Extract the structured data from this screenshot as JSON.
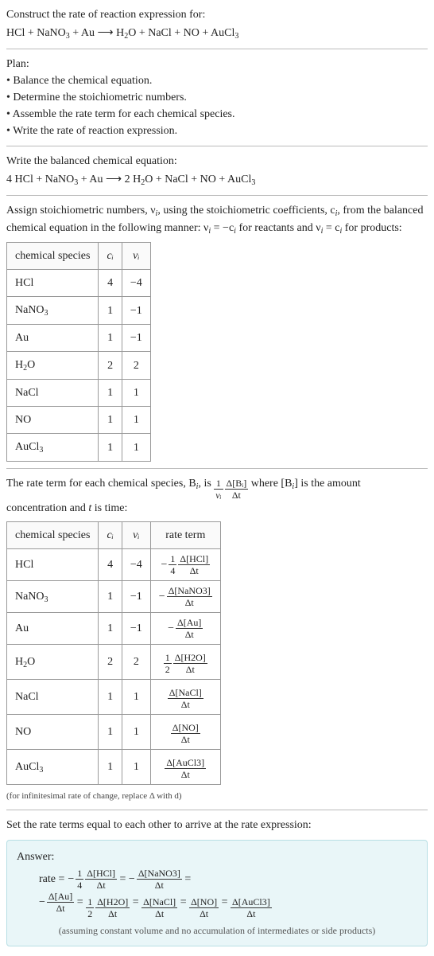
{
  "header": {
    "construct_label": "Construct the rate of reaction expression for:",
    "equation_a": "HCl + NaNO",
    "equation_b": " + Au  ⟶  H",
    "equation_c": "O + NaCl + NO + AuCl"
  },
  "plan": {
    "title": "Plan:",
    "items": [
      "• Balance the chemical equation.",
      "• Determine the stoichiometric numbers.",
      "• Assemble the rate term for each chemical species.",
      "• Write the rate of reaction expression."
    ]
  },
  "balanced": {
    "title": "Write the balanced chemical equation:",
    "eq_a": "4 HCl + NaNO",
    "eq_b": " + Au  ⟶  2 H",
    "eq_c": "O + NaCl + NO + AuCl"
  },
  "assign": {
    "line1_a": "Assign stoichiometric numbers, ν",
    "line1_b": ", using the stoichiometric coefficients, c",
    "line1_c": ", from",
    "line2_a": "the balanced chemical equation in the following manner: ν",
    "line2_b": " = −c",
    "line2_c": " for reactants",
    "line3_a": "and ν",
    "line3_b": " = c",
    "line3_c": " for products:"
  },
  "table1": {
    "headers": {
      "species": "chemical species",
      "c": "cᵢ",
      "v": "νᵢ"
    },
    "rows": [
      {
        "species_a": "HCl",
        "species_b": "",
        "c": "4",
        "v": "−4"
      },
      {
        "species_a": "NaNO",
        "species_b": "3",
        "c": "1",
        "v": "−1"
      },
      {
        "species_a": "Au",
        "species_b": "",
        "c": "1",
        "v": "−1"
      },
      {
        "species_a": "H",
        "species_b": "2",
        "species_c": "O",
        "c": "2",
        "v": "2"
      },
      {
        "species_a": "NaCl",
        "species_b": "",
        "c": "1",
        "v": "1"
      },
      {
        "species_a": "NO",
        "species_b": "",
        "c": "1",
        "v": "1"
      },
      {
        "species_a": "AuCl",
        "species_b": "3",
        "c": "1",
        "v": "1"
      }
    ]
  },
  "rate_intro": {
    "a": "The rate term for each chemical species, B",
    "b": ", is ",
    "c": " where [B",
    "d": "] is the amount",
    "line2": "concentration and t is time:",
    "frac1_num": "1",
    "frac1_den": "νᵢ",
    "frac2_num": "Δ[Bᵢ]",
    "frac2_den": "Δt"
  },
  "table2": {
    "headers": {
      "species": "chemical species",
      "c": "cᵢ",
      "v": "νᵢ",
      "rate": "rate term"
    },
    "rows": [
      {
        "species_a": "HCl",
        "c": "4",
        "v": "−4",
        "sign": "−",
        "coef_num": "1",
        "coef_den": "4",
        "num": "Δ[HCl]",
        "den": "Δt"
      },
      {
        "species_a": "NaNO",
        "species_b": "3",
        "c": "1",
        "v": "−1",
        "sign": "−",
        "coef_num": "",
        "coef_den": "",
        "num": "Δ[NaNO3]",
        "den": "Δt"
      },
      {
        "species_a": "Au",
        "c": "1",
        "v": "−1",
        "sign": "−",
        "coef_num": "",
        "coef_den": "",
        "num": "Δ[Au]",
        "den": "Δt"
      },
      {
        "species_a": "H",
        "species_b": "2",
        "species_c": "O",
        "c": "2",
        "v": "2",
        "sign": "",
        "coef_num": "1",
        "coef_den": "2",
        "num": "Δ[H2O]",
        "den": "Δt"
      },
      {
        "species_a": "NaCl",
        "c": "1",
        "v": "1",
        "sign": "",
        "coef_num": "",
        "coef_den": "",
        "num": "Δ[NaCl]",
        "den": "Δt"
      },
      {
        "species_a": "NO",
        "c": "1",
        "v": "1",
        "sign": "",
        "coef_num": "",
        "coef_den": "",
        "num": "Δ[NO]",
        "den": "Δt"
      },
      {
        "species_a": "AuCl",
        "species_b": "3",
        "c": "1",
        "v": "1",
        "sign": "",
        "coef_num": "",
        "coef_den": "",
        "num": "Δ[AuCl3]",
        "den": "Δt"
      }
    ]
  },
  "infinitesimal_note": "(for infinitesimal rate of change, replace Δ with d)",
  "set_equal": "Set the rate terms equal to each other to arrive at the rate expression:",
  "answer": {
    "title": "Answer:",
    "rate_label": "rate = ",
    "terms": [
      {
        "sign": "−",
        "coef_num": "1",
        "coef_den": "4",
        "num": "Δ[HCl]",
        "den": "Δt",
        "tail": " = "
      },
      {
        "sign": "−",
        "coef_num": "",
        "coef_den": "",
        "num": "Δ[NaNO3]",
        "den": "Δt",
        "tail": " ="
      }
    ],
    "terms2": [
      {
        "sign": "−",
        "coef_num": "",
        "coef_den": "",
        "num": "Δ[Au]",
        "den": "Δt",
        "tail": " = "
      },
      {
        "sign": "",
        "coef_num": "1",
        "coef_den": "2",
        "num": "Δ[H2O]",
        "den": "Δt",
        "tail": " = "
      },
      {
        "sign": "",
        "coef_num": "",
        "coef_den": "",
        "num": "Δ[NaCl]",
        "den": "Δt",
        "tail": " = "
      },
      {
        "sign": "",
        "coef_num": "",
        "coef_den": "",
        "num": "Δ[NO]",
        "den": "Δt",
        "tail": " = "
      },
      {
        "sign": "",
        "coef_num": "",
        "coef_den": "",
        "num": "Δ[AuCl3]",
        "den": "Δt",
        "tail": ""
      }
    ],
    "note": "(assuming constant volume and no accumulation of intermediates or side products)"
  }
}
